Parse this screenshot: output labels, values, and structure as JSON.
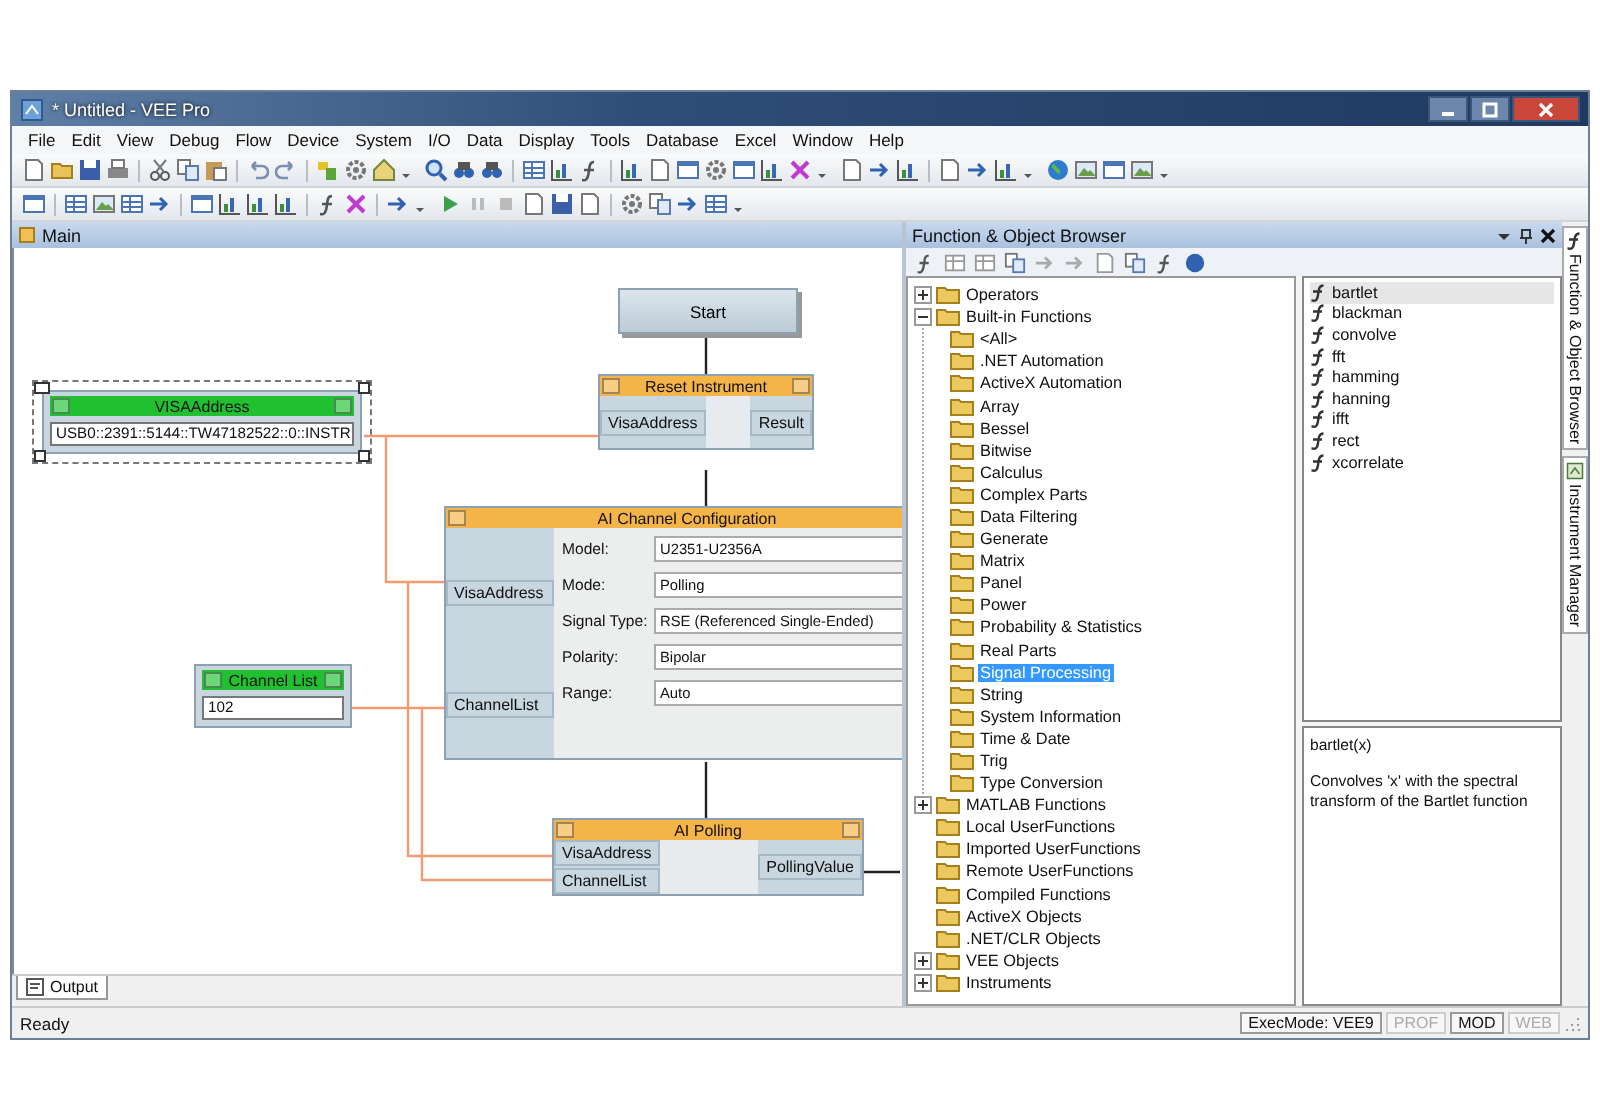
{
  "window": {
    "title": "* Untitled - VEE Pro"
  },
  "menu": [
    "File",
    "Edit",
    "View",
    "Debug",
    "Flow",
    "Device",
    "System",
    "I/O",
    "Data",
    "Display",
    "Tools",
    "Database",
    "Excel",
    "Window",
    "Help"
  ],
  "main_panel": {
    "title": "Main",
    "nodes": [
      {
        "kind": "button",
        "title": "Start"
      },
      {
        "kind": "constant",
        "title": "VISAAddress",
        "value": "USB0::2391::5144::TW47182522::0::INSTR",
        "selected": true
      },
      {
        "kind": "formula",
        "title": "Reset Instrument",
        "inputs": [
          "VisaAddress"
        ],
        "outputs": [
          "Result"
        ]
      },
      {
        "kind": "constant",
        "title": "Channel List",
        "value": "102",
        "selected": false
      },
      {
        "kind": "config",
        "title": "AI Channel Configuration",
        "inputs": [
          "VisaAddress",
          "ChannelList"
        ],
        "fields": [
          {
            "label": "Model:",
            "value": "U2351-U2356A"
          },
          {
            "label": "Mode:",
            "value": "Polling"
          },
          {
            "label": "Signal Type:",
            "value": "RSE (Referenced Single-Ended)"
          },
          {
            "label": "Polarity:",
            "value": "Bipolar"
          },
          {
            "label": "Range:",
            "value": "Auto"
          }
        ]
      },
      {
        "kind": "formula",
        "title": "AI Polling",
        "inputs": [
          "VisaAddress",
          "ChannelList"
        ],
        "outputs": [
          "PollingValue"
        ]
      }
    ],
    "output_tab": "Output"
  },
  "browser": {
    "title": "Function & Object Browser",
    "tree": [
      {
        "label": "Operators",
        "kind": "group",
        "expanded": false,
        "selected": false
      },
      {
        "label": "Built-in Functions",
        "kind": "group",
        "expanded": true,
        "selected": false,
        "children": [
          {
            "label": "<All>",
            "selected": false
          },
          {
            "label": ".NET Automation",
            "selected": false
          },
          {
            "label": "ActiveX Automation",
            "selected": false
          },
          {
            "label": "Array",
            "selected": false
          },
          {
            "label": "Bessel",
            "selected": false
          },
          {
            "label": "Bitwise",
            "selected": false
          },
          {
            "label": "Calculus",
            "selected": false
          },
          {
            "label": "Complex Parts",
            "selected": false
          },
          {
            "label": "Data Filtering",
            "selected": false
          },
          {
            "label": "Generate",
            "selected": false
          },
          {
            "label": "Matrix",
            "selected": false
          },
          {
            "label": "Panel",
            "selected": false
          },
          {
            "label": "Power",
            "selected": false
          },
          {
            "label": "Probability & Statistics",
            "selected": false
          },
          {
            "label": "Real Parts",
            "selected": false
          },
          {
            "label": "Signal Processing",
            "selected": true
          },
          {
            "label": "String",
            "selected": false
          },
          {
            "label": "System Information",
            "selected": false
          },
          {
            "label": "Time & Date",
            "selected": false
          },
          {
            "label": "Trig",
            "selected": false
          },
          {
            "label": "Type Conversion",
            "selected": false
          }
        ]
      },
      {
        "label": "MATLAB Functions",
        "kind": "group",
        "expanded": false,
        "selected": false
      },
      {
        "label": "Local UserFunctions",
        "kind": "leaf",
        "selected": false
      },
      {
        "label": "Imported UserFunctions",
        "kind": "leaf",
        "selected": false
      },
      {
        "label": "Remote UserFunctions",
        "kind": "leaf",
        "selected": false
      },
      {
        "label": "Compiled Functions",
        "kind": "leaf",
        "selected": false
      },
      {
        "label": "ActiveX Objects",
        "kind": "leaf",
        "selected": false
      },
      {
        "label": ".NET/CLR Objects",
        "kind": "leaf",
        "selected": false
      },
      {
        "label": "VEE Objects",
        "kind": "group",
        "expanded": false,
        "selected": false
      },
      {
        "label": "Instruments",
        "kind": "group",
        "expanded": false,
        "selected": false
      }
    ],
    "functions": [
      {
        "label": "bartlet",
        "selected": true
      },
      {
        "label": "blackman",
        "selected": false
      },
      {
        "label": "convolve",
        "selected": false
      },
      {
        "label": "fft",
        "selected": false
      },
      {
        "label": "hamming",
        "selected": false
      },
      {
        "label": "hanning",
        "selected": false
      },
      {
        "label": "ifft",
        "selected": false
      },
      {
        "label": "rect",
        "selected": false
      },
      {
        "label": "xcorrelate",
        "selected": false
      }
    ],
    "description": {
      "signature": "bartlet(x)",
      "text": "Convolves 'x' with the spectral transform of the Bartlet function"
    }
  },
  "side_tabs": [
    "Function & Object Browser",
    "Instrument Manager"
  ],
  "status_bar": {
    "text": "Ready",
    "indicators": [
      {
        "label": "ExecMode: VEE9",
        "disabled": false
      },
      {
        "label": "PROF",
        "disabled": true
      },
      {
        "label": "MOD",
        "disabled": false
      },
      {
        "label": "WEB",
        "disabled": true
      }
    ]
  }
}
